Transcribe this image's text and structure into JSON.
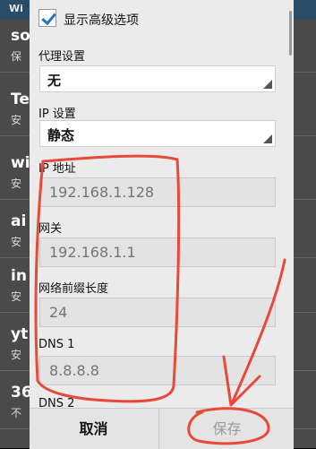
{
  "background": {
    "header": "Wi",
    "items": [
      {
        "title": "so",
        "subtitle": "保"
      },
      {
        "title": "Te",
        "subtitle": "安"
      },
      {
        "title": "wi",
        "subtitle": "安"
      },
      {
        "title": "ai",
        "subtitle": "安"
      },
      {
        "title": "in",
        "subtitle": "安"
      },
      {
        "title": "yt",
        "subtitle": "安"
      },
      {
        "title": "36",
        "subtitle": "不"
      }
    ]
  },
  "dialog": {
    "advanced_checkbox": {
      "label": "显示高级选项",
      "checked": true
    },
    "proxy": {
      "label": "代理设置",
      "value": "无"
    },
    "ip_settings": {
      "label": "IP 设置",
      "value": "静态"
    },
    "ip_address": {
      "label": "IP 地址",
      "placeholder": "192.168.1.128"
    },
    "gateway": {
      "label": "网关",
      "placeholder": "192.168.1.1"
    },
    "prefix_length": {
      "label": "网络前缀长度",
      "placeholder": "24"
    },
    "dns1": {
      "label": "DNS 1",
      "placeholder": "8.8.8.8"
    },
    "dns2": {
      "label": "DNS 2"
    }
  },
  "buttons": {
    "cancel": "取消",
    "save": "保存"
  },
  "colors": {
    "annotation": "#e8493a",
    "checkmark": "#1e73be",
    "header": "#2b4c66"
  }
}
